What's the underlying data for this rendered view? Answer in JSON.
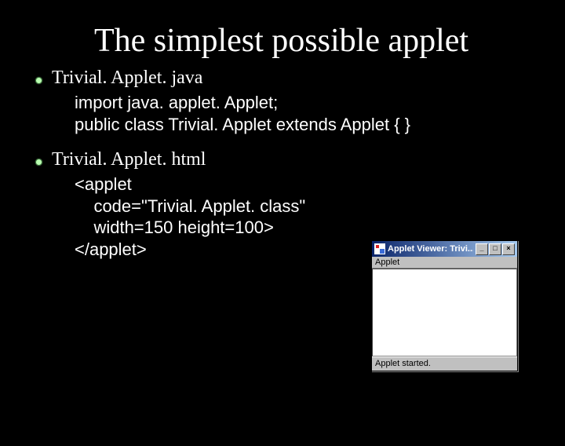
{
  "title": "The simplest possible applet",
  "section1": {
    "heading": "Trivial. Applet. java",
    "code_line1": "import java. applet. Applet;",
    "code_line2": "public class Trivial. Applet extends Applet { }"
  },
  "section2": {
    "heading": "Trivial. Applet. html",
    "code_line1": "<applet",
    "code_line2": "    code=\"Trivial. Applet. class\"",
    "code_line3": "    width=150 height=100>",
    "code_line4": "</applet>"
  },
  "applet_window": {
    "title": "Applet Viewer: Trivi...",
    "menu": "Applet",
    "status": "Applet started.",
    "buttons": {
      "min": "_",
      "max": "□",
      "close": "×"
    }
  }
}
